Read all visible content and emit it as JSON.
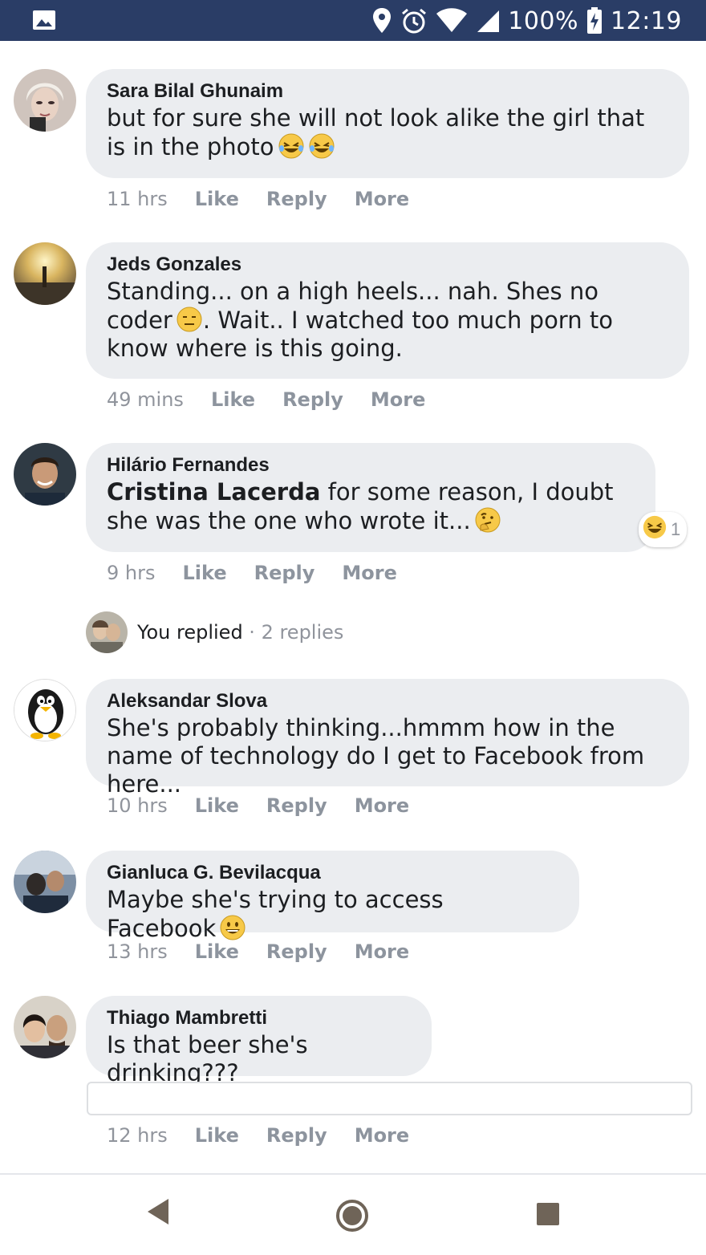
{
  "status_bar": {
    "battery": "100%",
    "time": "12:19",
    "icons": [
      "image-icon",
      "location-icon",
      "alarm-icon",
      "wifi-icon",
      "signal-icon",
      "battery-charging-icon"
    ]
  },
  "comments": [
    {
      "author": "Sara Bilal Ghunaim",
      "text": "but for sure she will not look alike the girl that is in the photo",
      "emojis": [
        "laughing-tears-emoji",
        "laughing-tears-emoji"
      ],
      "time": "11 hrs",
      "like": "Like",
      "reply": "Reply",
      "more": "More"
    },
    {
      "author": "Jeds Gonzales",
      "text_line1": "Standing... on a high heels... nah. Shes no coder",
      "text_line1_end": ".",
      "text_rest": "Wait.. I watched too much porn to know where is this going.",
      "emojis": [
        "expressionless-emoji"
      ],
      "time": "49 mins",
      "like": "Like",
      "reply": "Reply",
      "more": "More"
    },
    {
      "author": "Hilário Fernandes",
      "tag": "Cristina Lacerda",
      "text": " for some reason, I doubt she was the one who wrote it...",
      "emojis": [
        "thinking-emoji"
      ],
      "reaction_count": "1",
      "time": "9 hrs",
      "like": "Like",
      "reply": "Reply",
      "more": "More"
    },
    {
      "author": "Aleksandar Slova",
      "text": "She's probably thinking...hmmm how in the name of technology do I get to Facebook from here...",
      "time": "10 hrs",
      "like": "Like",
      "reply": "Reply",
      "more": "More"
    },
    {
      "author": "Gianluca G. Bevilacqua",
      "text": "Maybe she's trying to access Facebook",
      "emojis": [
        "grinning-emoji"
      ],
      "time": "13 hrs",
      "like": "Like",
      "reply": "Reply",
      "more": "More"
    },
    {
      "author": "Thiago Mambretti",
      "text": "Is that beer she's drinking???",
      "time": "12 hrs",
      "like": "Like",
      "reply": "Reply",
      "more": "More"
    }
  ],
  "replies_summary": {
    "label": "You replied",
    "separator": " · ",
    "count": "2 replies"
  },
  "colors": {
    "status_bar": "#2a3d66",
    "bubble": "#ebedf0",
    "meta_text": "#8d949e"
  },
  "nav": {
    "icons": [
      "back-icon",
      "home-icon",
      "recents-icon"
    ]
  }
}
